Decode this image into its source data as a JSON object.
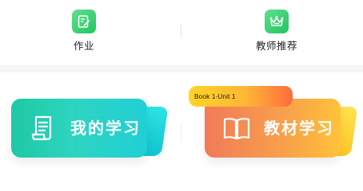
{
  "top_nav": {
    "homework": {
      "label": "作业",
      "icon": "edit-document-icon"
    },
    "teacher_recommend": {
      "label": "教师推荐",
      "icon": "crown-icon"
    }
  },
  "cards": {
    "my_study": {
      "title": "我的学习",
      "icon": "scroll-document-icon"
    },
    "textbook_study": {
      "title": "教材学习",
      "icon": "open-book-icon",
      "badge": "Book 1-Unit 1"
    }
  },
  "colors": {
    "nav_icon_green": "#22c55e",
    "study_card_start": "#1fc8a5",
    "study_card_end": "#20d0d6",
    "book_card_start": "#f17b57",
    "book_card_end": "#ffc238",
    "badge_start": "#ffd426",
    "badge_end": "#ff6b3d"
  }
}
